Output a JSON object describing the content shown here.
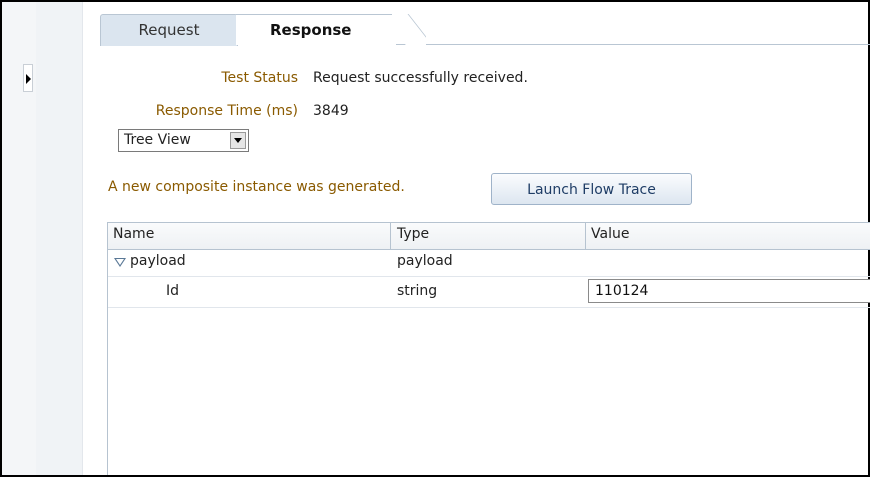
{
  "tabs": {
    "request_label": "Request",
    "response_label": "Response",
    "active": "Response"
  },
  "response": {
    "test_status_label": "Test Status",
    "test_status_value": "Request successfully received.",
    "response_time_label": "Response Time (ms)",
    "response_time_value": "3849",
    "view_select": "Tree View",
    "notice": "A new composite instance was generated.",
    "launch_button": "Launch Flow Trace"
  },
  "table": {
    "headers": [
      "Name",
      "Type",
      "Value"
    ],
    "rows": [
      {
        "name": "payload",
        "type": "payload",
        "value": "",
        "expanded": true
      },
      {
        "name": "Id",
        "type": "string",
        "value": "110124"
      }
    ]
  },
  "colors": {
    "label_color": "#8a5a00",
    "tab_inactive_bg": "#dbe5ef",
    "button_text": "#1f3d66"
  },
  "icons": [
    "expand-right-icon",
    "dropdown-arrow-icon",
    "tree-collapse-icon"
  ]
}
